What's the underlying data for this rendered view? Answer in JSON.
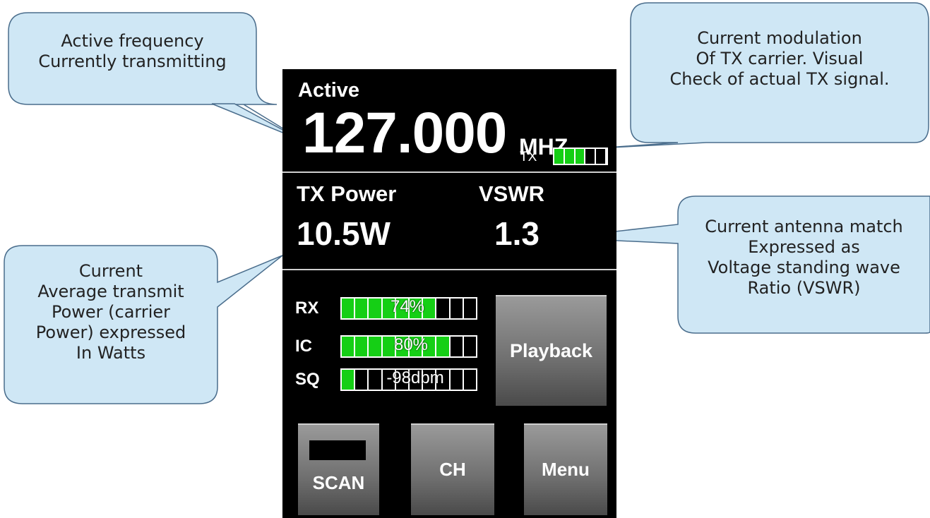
{
  "screen": {
    "active_label": "Active",
    "frequency": "127.000",
    "frequency_unit": "MHZ",
    "tx_label": "TX",
    "tx_meter": {
      "segments": 5,
      "filled": 3
    },
    "tx_power_label": "TX Power",
    "tx_power_value": "10.5W",
    "vswr_label": "VSWR",
    "vswr_value": "1.3",
    "meters": [
      {
        "label": "RX",
        "text": "74%",
        "filled": 7,
        "segments": 10
      },
      {
        "label": "IC",
        "text": "80%",
        "filled": 8,
        "segments": 10
      },
      {
        "label": "SQ",
        "text": "-98dbm",
        "filled": 1,
        "segments": 10
      }
    ],
    "buttons": {
      "playback": "Playback",
      "scan": "SCAN",
      "ch": "CH",
      "menu": "Menu"
    }
  },
  "callouts": {
    "active_frequency": [
      "Active frequency",
      "Currently transmitting"
    ],
    "modulation": [
      "Current modulation",
      "Of TX carrier. Visual",
      "Check of actual TX signal."
    ],
    "power": [
      "Current",
      "Average transmit",
      "Power (carrier",
      "Power) expressed",
      "In Watts"
    ],
    "antenna": [
      "Current antenna match",
      "Expressed as",
      "Voltage standing wave",
      "Ratio (VSWR)"
    ]
  },
  "colors": {
    "screen_bg": "#000000",
    "meter_green": "#15cf15",
    "callout_fill": "#cfe7f5",
    "callout_stroke": "#4a6d8c",
    "button_gray": "#7a7a7a"
  }
}
